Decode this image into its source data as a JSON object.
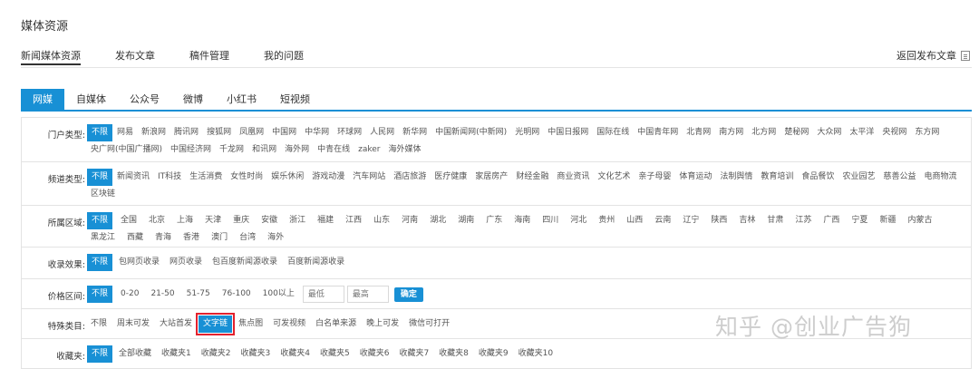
{
  "page_title": "媒体资源",
  "top_tabs": [
    "新闻媒体资源",
    "发布文章",
    "稿件管理",
    "我的问题"
  ],
  "return_link": "返回发布文章",
  "type_tabs": [
    "网媒",
    "自媒体",
    "公众号",
    "微博",
    "小红书",
    "短视频"
  ],
  "filters": {
    "portal": {
      "label": "门户类型:",
      "options": [
        "不限",
        "网易",
        "新浪网",
        "腾讯网",
        "搜狐网",
        "凤凰网",
        "中国网",
        "中华网",
        "环球网",
        "人民网",
        "新华网",
        "中国新闻网(中新网)",
        "光明网",
        "中国日报网",
        "国际在线",
        "中国青年网",
        "北青网",
        "南方网",
        "北方网",
        "楚秘网",
        "大众网",
        "太平洋",
        "央视网",
        "东方网",
        "央广网(中国广播网)",
        "中国经济网",
        "千龙网",
        "和讯网",
        "海外网",
        "中青在线",
        "zaker",
        "海外媒体"
      ]
    },
    "channel": {
      "label": "频道类型:",
      "options": [
        "不限",
        "新闻资讯",
        "IT科技",
        "生活消费",
        "女性时尚",
        "娱乐休闲",
        "游戏动漫",
        "汽车网站",
        "酒店旅游",
        "医疗健康",
        "家居房产",
        "财经金融",
        "商业资讯",
        "文化艺术",
        "亲子母婴",
        "体育运动",
        "法制舆情",
        "教育培训",
        "食品餐饮",
        "农业园艺",
        "慈善公益",
        "电商物流",
        "区块链"
      ]
    },
    "region": {
      "label": "所属区域:",
      "options": [
        "不限",
        "全国",
        "北京",
        "上海",
        "天津",
        "重庆",
        "安徽",
        "浙江",
        "福建",
        "江西",
        "山东",
        "河南",
        "湖北",
        "湖南",
        "广东",
        "海南",
        "四川",
        "河北",
        "贵州",
        "山西",
        "云南",
        "辽宁",
        "陕西",
        "吉林",
        "甘肃",
        "江苏",
        "广西",
        "宁夏",
        "新疆",
        "内蒙古",
        "黑龙江",
        "西藏",
        "青海",
        "香港",
        "澳门",
        "台湾",
        "海外"
      ]
    },
    "effect": {
      "label": "收录效果:",
      "options": [
        "不限",
        "包网页收录",
        "网页收录",
        "包百度新闻源收录",
        "百度新闻源收录"
      ]
    },
    "price": {
      "label": "价格区间:",
      "options": [
        "不限",
        "0-20",
        "21-50",
        "51-75",
        "76-100",
        "100以上"
      ],
      "min_placeholder": "最低",
      "max_placeholder": "最高",
      "confirm": "确定"
    },
    "special": {
      "label": "特殊类目:",
      "options": [
        "不限",
        "周末可发",
        "大站首发",
        "文字链",
        "焦点图",
        "可发视频",
        "白名单来源",
        "晚上可发",
        "微信可打开"
      ]
    },
    "favorites": {
      "label": "收藏夹:",
      "options": [
        "不限",
        "全部收藏",
        "收藏夹1",
        "收藏夹2",
        "收藏夹3",
        "收藏夹4",
        "收藏夹5",
        "收藏夹6",
        "收藏夹7",
        "收藏夹8",
        "收藏夹9",
        "收藏夹10"
      ]
    }
  },
  "watermark": "知乎 @创业广告狗",
  "colors": {
    "accent": "#1890d5",
    "highlight": "#e3222e"
  }
}
